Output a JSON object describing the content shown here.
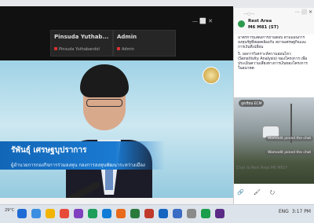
{
  "meeting": {
    "tiles": [
      {
        "name": "Pinsuda  Yuthab...",
        "sub": "Pinsuda Yuthabandol"
      },
      {
        "name": "Admin",
        "sub": "Admin"
      }
    ],
    "controls": "—   ⬜   ✕",
    "speaker_name": "รัพันธุ์  เศรษฐบุปราการ",
    "speaker_title": "ผู้อำนวยการกองกิจการร่วมลงทุน  กองการลงทุนพัฒนาระหว่างเมือง"
  },
  "chat": {
    "header_icons": "⋯  ⬜  ✕",
    "title": "Rest Area",
    "subtitle": "M6 M81 (ST)",
    "message_paragraphs": [
      "มาตรการแสดงการถามตอบ ตามแผนการลงทุนรัฐที่สอดคล้องกับ สภาพเศรษฐกิจและการเงินที่เปลี่ยน",
      "5. ผลการวิเคราะห์ความอ่อนไหว (Sensitivity Analysis) ของโครงการ เพื่อประเมินความเสี่ยงทางการเงินของโครงการในอนาคต"
    ],
    "chips": [
      "ลูกเรียน ECM"
    ],
    "joined": [
      "Wamadit joined the chat",
      "Wamadit joined the chat"
    ],
    "prompt": "Chat to Rest Area M6 M81?",
    "tools": "🔗 🖌 ⭮"
  },
  "taskbar": {
    "weather": "29°C",
    "tray": [
      "ENG",
      "3:17 PM"
    ],
    "app_icon_colors": [
      "#1e6bd6",
      "#3b8fe0",
      "#f2b400",
      "#e84a3a",
      "#7f3fbf",
      "#1d9f5a",
      "#0f7bd6",
      "#e86a1a",
      "#2a7a3a",
      "#c0392b",
      "#1565c0",
      "#3b6cc4",
      "#8a8a8a",
      "#1b9e4b",
      "#5b2a86"
    ]
  },
  "colors": {
    "lower_third": "#1266b7",
    "avatar": "#2b9a4c"
  }
}
